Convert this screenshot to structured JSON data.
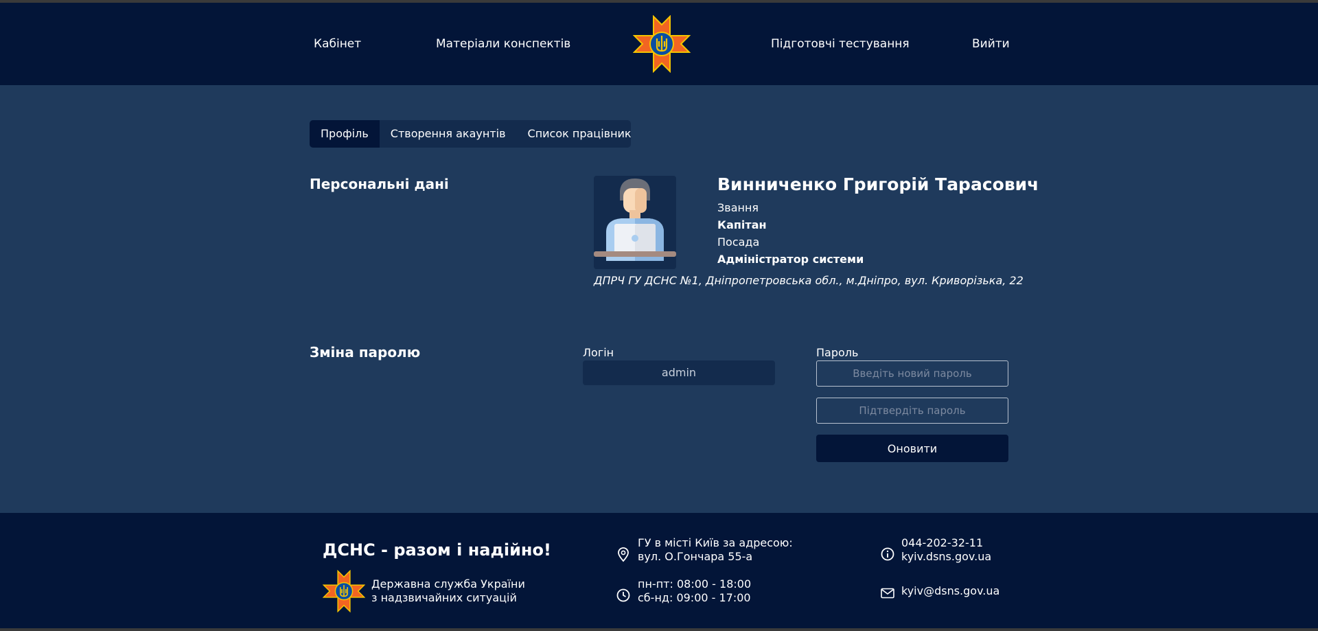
{
  "header": {
    "nav": {
      "cabinet": "Кабінет",
      "materials": "Матеріали конспектів",
      "testing": "Підготовчі тестування",
      "logout": "Вийти"
    }
  },
  "tabs": [
    {
      "label": "Профіль",
      "active": true
    },
    {
      "label": "Створення акаунтів",
      "active": false
    },
    {
      "label": "Список працівників",
      "active": false
    }
  ],
  "profile": {
    "section_title": "Персональні дані",
    "name": "Винниченко Григорій Тарасович",
    "rank_label": "Звання",
    "rank_value": "Капітан",
    "position_label": "Посада",
    "position_value": "Адміністратор системи",
    "address": "ДПРЧ ГУ ДСНС №1, Дніпропетровська обл., м.Дніпро, вул. Криворізька, 22"
  },
  "password_change": {
    "section_title": "Зміна паролю",
    "login_label": "Логін",
    "login_value": "admin",
    "password_label": "Пароль",
    "new_password_placeholder": "Введіть новий пароль",
    "confirm_password_placeholder": "Підтвердіть пароль",
    "update_button": "Оновити"
  },
  "footer": {
    "slogan": "ДСНС - разом і надійно!",
    "org_line1": "Державна служба України",
    "org_line2": "з надзвичайних ситуацій",
    "address_line1": "ГУ в місті Київ за адресою:",
    "address_line2": "вул. О.Гончара 55-а",
    "hours_line1": "пн-пт: 08:00 - 18:00",
    "hours_line2": "сб-нд: 09:00 - 17:00",
    "phone": "044-202-32-11",
    "website": "kyiv.dsns.gov.ua",
    "email": "kyiv@dsns.gov.ua"
  },
  "colors": {
    "header_bg": "#031538",
    "page_bg": "#1f3a5c",
    "emblem_orange": "#f26522",
    "emblem_blue": "#0b4ea2",
    "emblem_gold": "#f5c400"
  },
  "icons": {
    "header_logo": "dsns-emblem-icon",
    "footer_logo": "dsns-emblem-icon",
    "address": "location-pin-icon",
    "hours": "clock-icon",
    "phone": "info-icon",
    "email": "envelope-icon"
  }
}
